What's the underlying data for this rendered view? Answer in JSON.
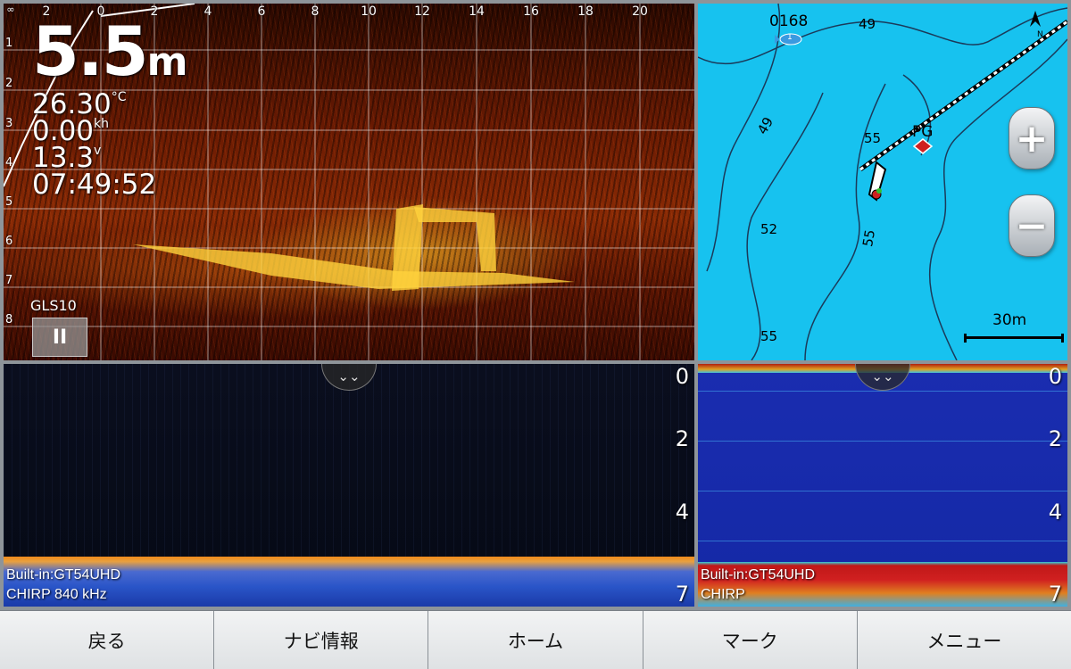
{
  "livescope": {
    "depth_value": "5.5",
    "depth_unit": "m",
    "temperature": "26.30",
    "temperature_unit": "°C",
    "speed": "0.00",
    "speed_unit": "kh",
    "voltage": "13.3",
    "voltage_unit": "v",
    "time": "07:49:52",
    "source_label": "GLS10",
    "x_ticks": [
      "∞",
      "2",
      "0",
      "2",
      "4",
      "6",
      "8",
      "10",
      "12",
      "14",
      "16",
      "18",
      "20"
    ],
    "y_ticks": [
      "1",
      "2",
      "3",
      "4",
      "5",
      "6",
      "7",
      "8"
    ],
    "pause_label": "II"
  },
  "chart": {
    "waypoint_number": "0168",
    "waypoint_marker": "1",
    "mark_label": "PG",
    "depth_contours": [
      "49",
      "49",
      "55",
      "52",
      "55",
      "55"
    ],
    "scale_label": "30m",
    "north_label": "N",
    "zoom_in_label": "+",
    "zoom_out_label": "−",
    "water_color": "#17c2ef"
  },
  "clearvu": {
    "source": "Built-in:GT54UHD",
    "frequency": "CHIRP 840 kHz",
    "depth_ticks": [
      "0",
      "2",
      "4",
      "7"
    ],
    "bottom_color": "#f08a1a"
  },
  "traditional": {
    "source": "Built-in:GT54UHD",
    "frequency": "CHIRP",
    "depth_ticks": [
      "0",
      "2",
      "4",
      "7"
    ],
    "bottom_color": "#d02020"
  },
  "menu": {
    "back": "戻る",
    "nav_info": "ナビ情報",
    "home": "ホーム",
    "mark": "マーク",
    "menu": "メニュー"
  }
}
